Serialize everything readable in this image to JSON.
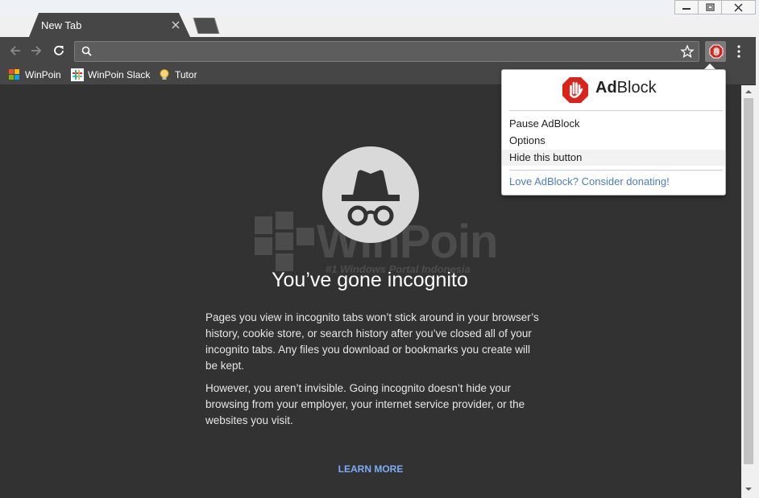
{
  "browser": {
    "tab_title": "New Tab",
    "omnibox_value": "",
    "omnibox_placeholder": ""
  },
  "bookmarks": [
    {
      "label": "WinPoin",
      "icon": "winpoin-favicon"
    },
    {
      "label": "WinPoin Slack",
      "icon": "slack-favicon"
    },
    {
      "label": "Tutor",
      "icon": "bulb-favicon"
    }
  ],
  "incognito": {
    "title": "You’ve gone incognito",
    "paragraph_1": "Pages you view in incognito tabs won’t stick around in your browser’s history, cookie store, or search history after you’ve closed all of your incognito tabs. Any files you download or bookmarks you create will be kept.",
    "paragraph_2": "However, you aren’t invisible. Going incognito doesn’t hide your browsing from your employer, your internet service provider, or the websites you visit.",
    "learn_more": "LEARN MORE"
  },
  "watermark": {
    "name": "WinPoin",
    "tagline": "#1 Windows Portal Indonesia"
  },
  "adblock_popup": {
    "brand_prefix": "Ad",
    "brand_suffix": "Block",
    "items": [
      "Pause AdBlock",
      "Options",
      "Hide this button"
    ],
    "donate_link": "Love AdBlock? Consider donating!"
  },
  "colors": {
    "content_bg": "#323232",
    "toolbar_bg": "#464646",
    "adblock_red": "#d9241c",
    "link_blue": "#7cacf8"
  }
}
